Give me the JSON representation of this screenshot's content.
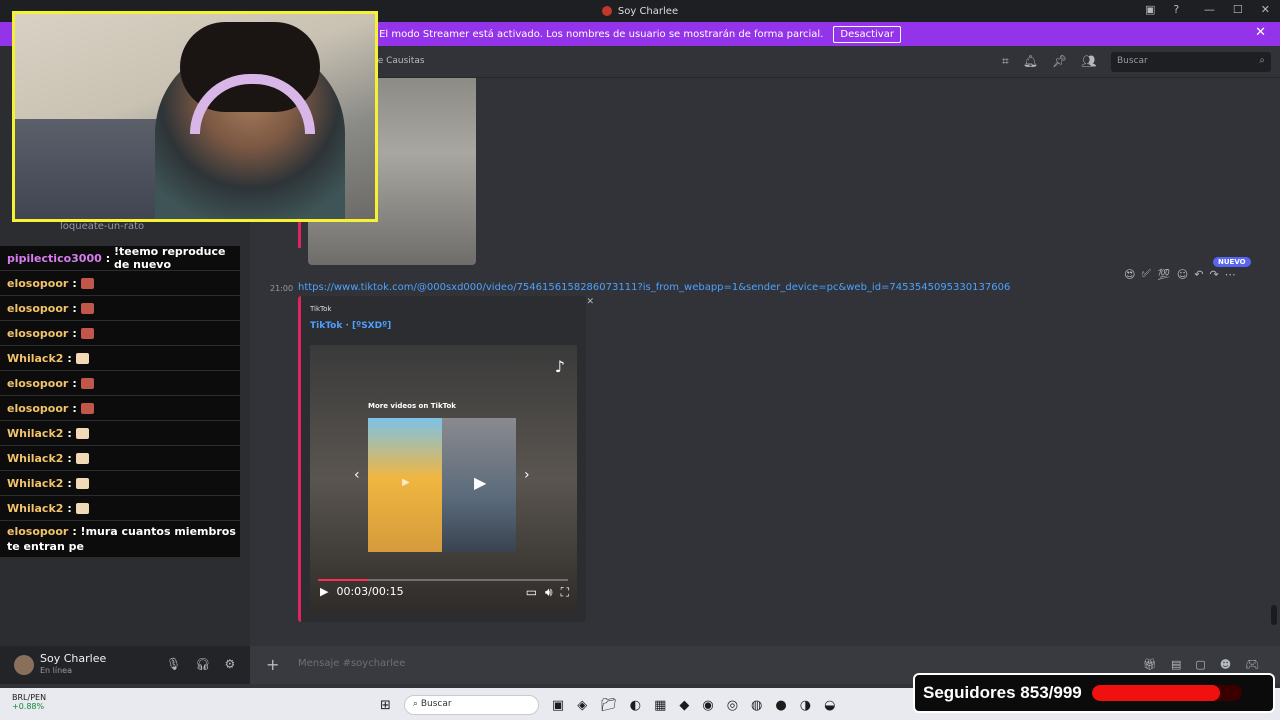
{
  "window": {
    "title": "Soy Charlee"
  },
  "banner": {
    "text": "El modo Streamer está activado. Los nombres de usuario se mostrarán de forma parcial.",
    "button": "Desactivar"
  },
  "header": {
    "channel": "pe Causitas",
    "search_placeholder": "Buscar"
  },
  "sidebar": {
    "channel_under": "loqueate-un-rato"
  },
  "chat": {
    "messages": [
      {
        "user": "pipilectico3000",
        "text": "!teemo reproduce de nuevo",
        "emote": ""
      },
      {
        "user": "elosopoor",
        "text": "",
        "emote": "brick"
      },
      {
        "user": "elosopoor",
        "text": "",
        "emote": "brick"
      },
      {
        "user": "elosopoor",
        "text": "",
        "emote": "brick"
      },
      {
        "user": "Whilack2",
        "text": "",
        "emote": "cream"
      },
      {
        "user": "elosopoor",
        "text": "",
        "emote": "brick"
      },
      {
        "user": "elosopoor",
        "text": "",
        "emote": "brick"
      },
      {
        "user": "Whilack2",
        "text": "",
        "emote": "cream"
      },
      {
        "user": "Whilack2",
        "text": "",
        "emote": "cream"
      },
      {
        "user": "Whilack2",
        "text": "",
        "emote": "cream"
      },
      {
        "user": "Whilack2",
        "text": "",
        "emote": "cream"
      },
      {
        "user": "elosopoor",
        "text": "!mura cuantos miembros te entran pe",
        "emote": ""
      }
    ]
  },
  "message": {
    "timestamp": "21:00",
    "link": "https://www.tiktok.com/@000sxd000/video/7546156158286073111?is_from_webapp=1&sender_device=pc&web_id=7453545095330137606",
    "new_badge": "NUEVO"
  },
  "embed": {
    "provider": "TikTok",
    "title": "TikTok · [ºSXDº]",
    "more_videos": "More videos on TikTok",
    "time": "00:03/00:15",
    "progress": 0.2
  },
  "composer": {
    "placeholder": "Mensaje #soycharlee"
  },
  "user": {
    "name": "Soy Charlee",
    "status": "En línea"
  },
  "taskbar": {
    "currency": "BRL/PEN",
    "change": "+0.88%",
    "search": "Buscar"
  },
  "followers": {
    "label": "Seguidores 853/999",
    "current": 853,
    "goal": 999
  },
  "colors": {
    "accent": "#9333ea",
    "link": "#4ea1ff",
    "embed_bar": "#e0245e",
    "webcam_border": "#f5f233"
  }
}
